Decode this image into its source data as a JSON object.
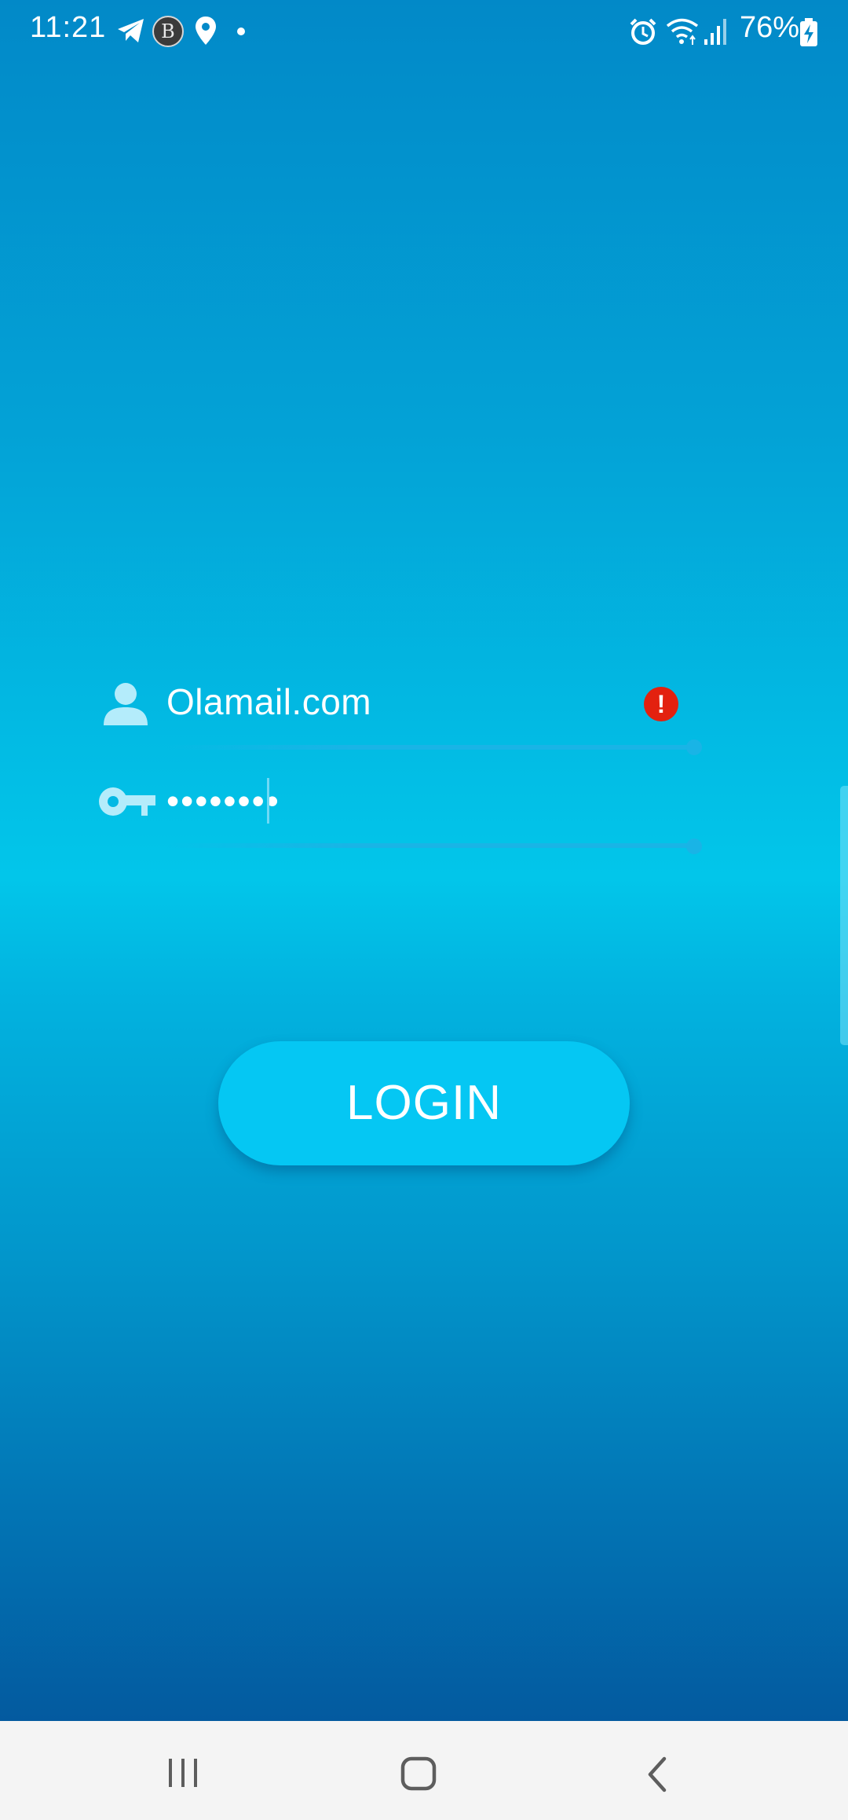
{
  "status_bar": {
    "time": "11:21",
    "battery_percent": "76%",
    "icons": [
      "telegram-icon",
      "b-app-icon",
      "location-icon",
      "notification-dot-icon",
      "alarm-icon",
      "wifi-icon",
      "signal-icon",
      "battery-charging-icon"
    ]
  },
  "login_form": {
    "email": {
      "value": "Olamail.com",
      "icon": "person-icon",
      "status": "error",
      "status_icon": "error-icon",
      "status_symbol": "!"
    },
    "password": {
      "masked_value": "••••••••",
      "icon": "key-icon"
    },
    "login_button_label": "LOGIN"
  },
  "navigation_bar": {
    "buttons": [
      "recent-apps-icon",
      "home-icon",
      "back-icon"
    ]
  },
  "colors": {
    "gradient_top": "#0289c8",
    "gradient_mid": "#02c6ea",
    "gradient_bottom": "#035a9f",
    "button": "#05c7f3",
    "error": "#e3210f",
    "nav_bar": "#f4f4f4"
  }
}
